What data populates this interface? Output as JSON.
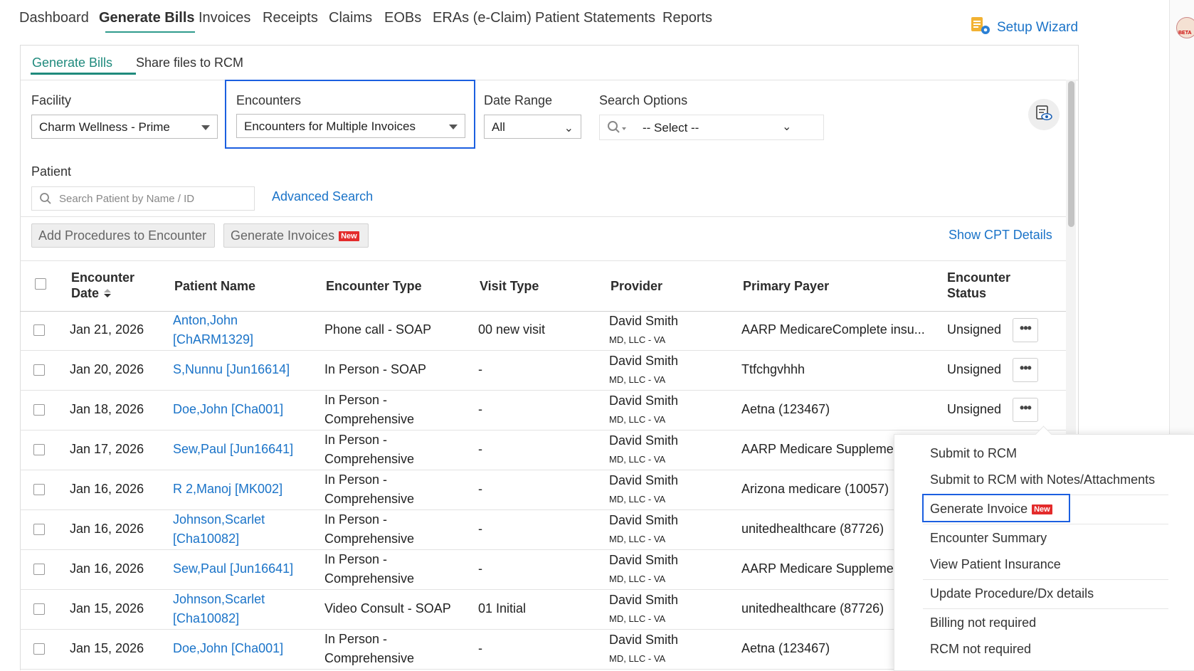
{
  "topnav": {
    "items": [
      "Dashboard",
      "Generate Bills",
      "Invoices",
      "Receipts",
      "Claims",
      "EOBs",
      "ERAs (e-Claim)",
      "Patient Statements",
      "Reports"
    ],
    "setup_wizard": "Setup Wizard",
    "beta_label": "BETA"
  },
  "subtabs": [
    "Generate Bills",
    "Share files to RCM"
  ],
  "filters": {
    "facility_label": "Facility",
    "facility_value": "Charm Wellness - Prime",
    "encounters_label": "Encounters",
    "encounters_value": "Encounters for Multiple Invoices",
    "date_range_label": "Date Range",
    "date_range_value": "All",
    "search_options_label": "Search Options",
    "search_options_value": "-- Select --",
    "patient_label": "Patient",
    "patient_placeholder": "Search Patient by Name / ID",
    "advanced_search": "Advanced Search"
  },
  "actions": {
    "add_procedures": "Add Procedures to Encounter",
    "generate_invoices": "Generate Invoices",
    "new_badge": "New",
    "show_cpt": "Show CPT Details"
  },
  "table": {
    "headers": {
      "encounter_date_1": "Encounter",
      "encounter_date_2": "Date",
      "patient_name": "Patient Name",
      "encounter_type": "Encounter Type",
      "visit_type": "Visit Type",
      "provider": "Provider",
      "primary_payer": "Primary Payer",
      "encounter_status_1": "Encounter",
      "encounter_status_2": "Status"
    },
    "rows": [
      {
        "date": "Jan 21, 2026",
        "patient_1": "Anton,John",
        "patient_2": "[ChARM1329]",
        "type_1": "Phone call - SOAP",
        "type_2": "",
        "visit": "00 new visit",
        "provider": "David Smith",
        "provider_sub": "MD, LLC - VA",
        "payer": "AARP MedicareComplete insu...",
        "status": "Unsigned"
      },
      {
        "date": "Jan 20, 2026",
        "patient_1": "S,Nunnu [Jun16614]",
        "patient_2": "",
        "type_1": "In Person - SOAP",
        "type_2": "",
        "visit": "-",
        "provider": "David Smith",
        "provider_sub": "MD, LLC - VA",
        "payer": "Ttfchgvhhh",
        "status": "Unsigned"
      },
      {
        "date": "Jan 18, 2026",
        "patient_1": "Doe,John [Cha001]",
        "patient_2": "",
        "type_1": "In Person -",
        "type_2": "Comprehensive",
        "visit": "-",
        "provider": "David Smith",
        "provider_sub": "MD, LLC - VA",
        "payer": "Aetna (123467)",
        "status": "Unsigned"
      },
      {
        "date": "Jan 17, 2026",
        "patient_1": "Sew,Paul [Jun16641]",
        "patient_2": "",
        "type_1": "In Person -",
        "type_2": "Comprehensive",
        "visit": "-",
        "provider": "David Smith",
        "provider_sub": "MD, LLC - VA",
        "payer": "AARP Medicare Suppleme",
        "status": ""
      },
      {
        "date": "Jan 16, 2026",
        "patient_1": "R 2,Manoj [MK002]",
        "patient_2": "",
        "type_1": "In Person -",
        "type_2": "Comprehensive",
        "visit": "-",
        "provider": "David Smith",
        "provider_sub": "MD, LLC - VA",
        "payer": "Arizona medicare (10057)",
        "status": ""
      },
      {
        "date": "Jan 16, 2026",
        "patient_1": "Johnson,Scarlet",
        "patient_2": "[Cha10082]",
        "type_1": "In Person -",
        "type_2": "Comprehensive",
        "visit": "-",
        "provider": "David Smith",
        "provider_sub": "MD, LLC - VA",
        "payer": "unitedhealthcare (87726)",
        "status": ""
      },
      {
        "date": "Jan 16, 2026",
        "patient_1": "Sew,Paul [Jun16641]",
        "patient_2": "",
        "type_1": "In Person -",
        "type_2": "Comprehensive",
        "visit": "-",
        "provider": "David Smith",
        "provider_sub": "MD, LLC - VA",
        "payer": "AARP Medicare Suppleme",
        "status": ""
      },
      {
        "date": "Jan 15, 2026",
        "patient_1": "Johnson,Scarlet",
        "patient_2": "[Cha10082]",
        "type_1": "Video Consult - SOAP",
        "type_2": "",
        "visit": "01 Initial",
        "provider": "David Smith",
        "provider_sub": "MD, LLC - VA",
        "payer": "unitedhealthcare (87726)",
        "status": ""
      },
      {
        "date": "Jan 15, 2026",
        "patient_1": "Doe,John [Cha001]",
        "patient_2": "",
        "type_1": "In Person -",
        "type_2": "Comprehensive",
        "visit": "-",
        "provider": "David Smith",
        "provider_sub": "MD, LLC - VA",
        "payer": "Aetna (123467)",
        "status": ""
      }
    ]
  },
  "context_menu": {
    "items": [
      "Submit to RCM",
      "Submit to RCM with Notes/Attachments",
      "Generate Invoice",
      "Encounter Summary",
      "View Patient Insurance",
      "Update Procedure/Dx details",
      "Billing not required",
      "RCM not required"
    ],
    "new_badge": "New"
  },
  "colors": {
    "link": "#1a73c8",
    "accent": "#1f8a7d",
    "highlight": "#1b5fe0",
    "new_badge": "#e32b2b"
  }
}
